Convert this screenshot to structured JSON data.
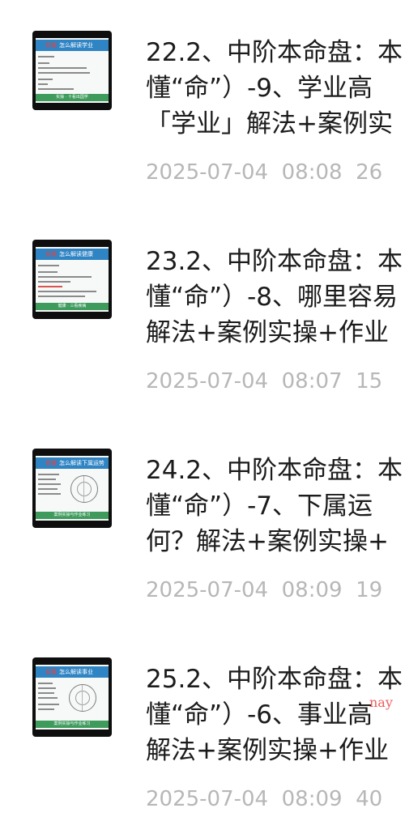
{
  "items": [
    {
      "title_lines": [
        "22.2、中阶本命盘：本",
        "懂“命”）-9、学业高",
        "「学业」解法+案例实"
      ],
      "date": "2025-07-04",
      "time": "08:08",
      "extra": "26",
      "thumb": {
        "heading_highlight": "实操",
        "heading": "怎么解读学业",
        "footer": "实操 · 十看出国学"
      }
    },
    {
      "title_lines": [
        "23.2、中阶本命盘：本",
        "懂“命”）-8、哪里容易",
        "解法+案例实操+作业"
      ],
      "date": "2025-07-04",
      "time": "08:07",
      "extra": "15",
      "thumb": {
        "heading_highlight": "实操",
        "heading": "怎么解读健康",
        "footer": "健康 · 三看疾病"
      }
    },
    {
      "title_lines": [
        "24.2、中阶本命盘：本",
        "懂“命”）-7、下属运",
        "何？解法+案例实操+"
      ],
      "date": "2025-07-04",
      "time": "08:09",
      "extra": "19",
      "thumb": {
        "heading_highlight": "实操",
        "heading": "怎么解读下属运势",
        "footer": "案例实操与作业练习"
      }
    },
    {
      "title_lines": [
        "25.2、中阶本命盘：本",
        "懂“命”）-6、事业高",
        "解法+案例实操+作业"
      ],
      "date": "2025-07-04",
      "time": "08:09",
      "extra": "40",
      "thumb": {
        "heading_highlight": "实操",
        "heading": "怎么解读事业",
        "footer": "案例实操与作业练习"
      }
    }
  ],
  "watermark": "nay"
}
